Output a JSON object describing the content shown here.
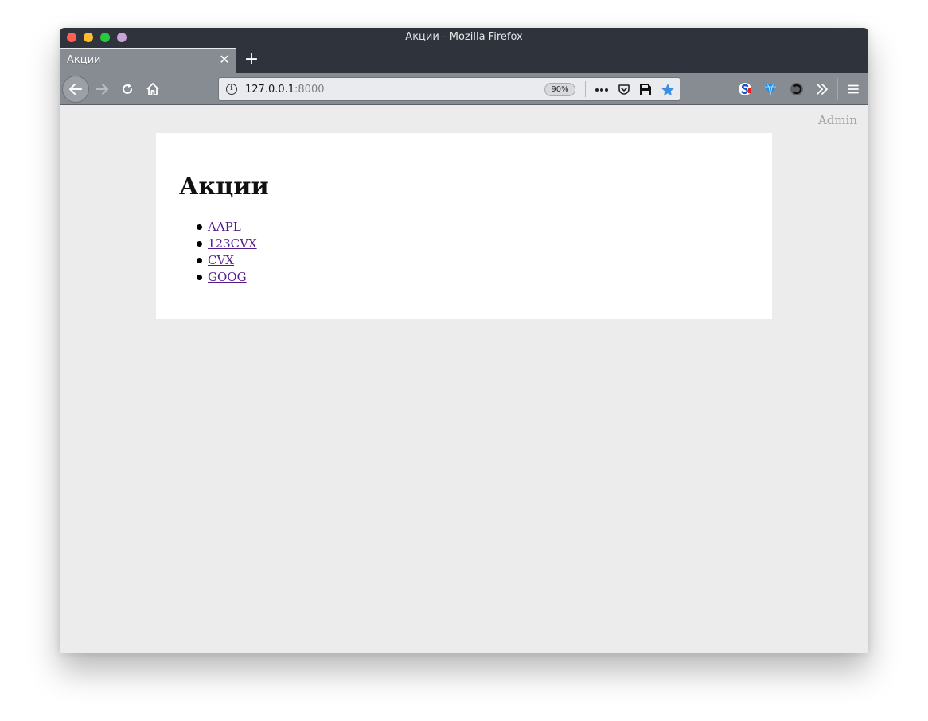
{
  "window": {
    "title": "Акции - Mozilla Firefox"
  },
  "tabs": [
    {
      "label": "Акции",
      "active": true
    }
  ],
  "toolbar": {
    "new_tab_label": "+"
  },
  "urlbar": {
    "host": "127.0.0.1",
    "port": ":8000",
    "zoom": "90%"
  },
  "page": {
    "admin_link": "Admin",
    "title": "Акции",
    "stocks": [
      "AAPL",
      "123CVX",
      "CVX",
      "GOOG"
    ]
  },
  "colors": {
    "titlebar": "#2f333b",
    "toolbar": "#878b92",
    "link_visited": "#551a8b",
    "admin_link": "#a2a2a2",
    "bookmark_star": "#3b8fe0"
  }
}
